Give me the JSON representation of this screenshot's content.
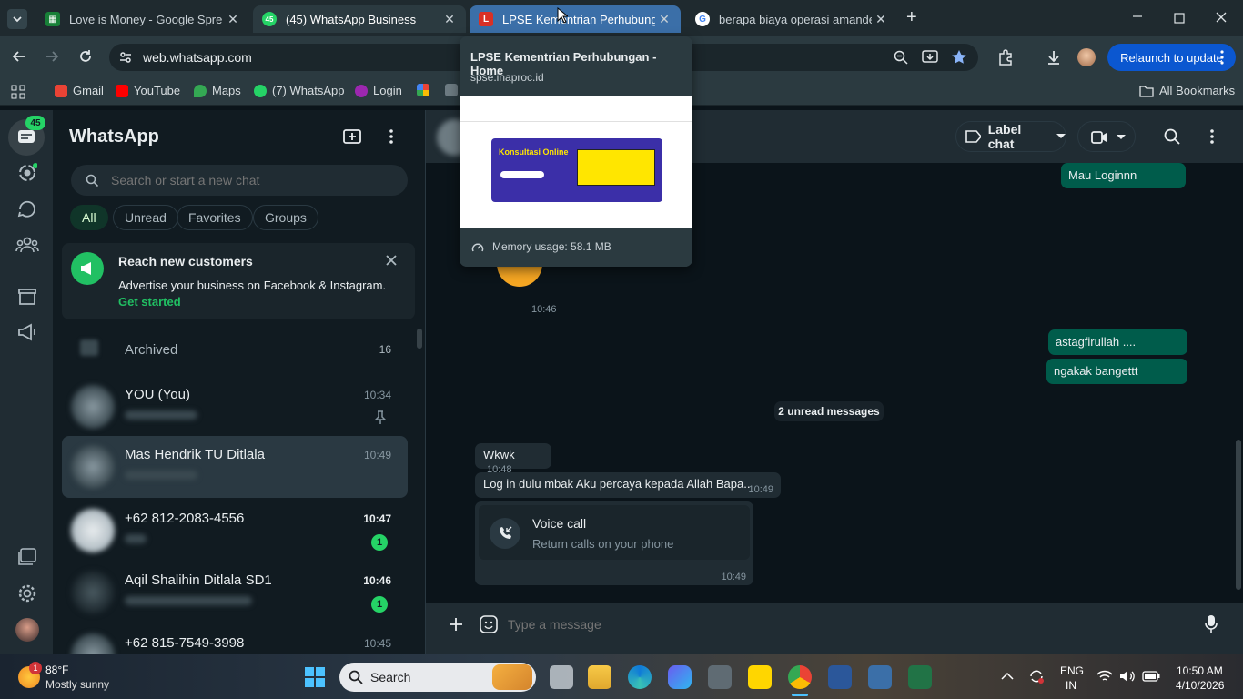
{
  "browser": {
    "tabs": [
      {
        "title": "Love is Money - Google Spreadsheets",
        "favicon": "sheets-icon",
        "color": "#188038"
      },
      {
        "title": "(45) WhatsApp Business",
        "favicon": "whatsapp-icon",
        "color": "#25d366",
        "badge": "45"
      },
      {
        "title": "LPSE Kementrian Perhubungan",
        "favicon": "lpse-icon",
        "color": "#d93025"
      },
      {
        "title": "berapa biaya operasi amandel",
        "favicon": "google-icon",
        "color": "#4285f4"
      }
    ],
    "url": "web.whatsapp.com",
    "relaunch_label": "Relaunch to update",
    "bookmarks": [
      {
        "label": "Gmail",
        "color": "#ea4335"
      },
      {
        "label": "YouTube",
        "color": "#ff0000"
      },
      {
        "label": "Maps",
        "color": "#34a853"
      },
      {
        "label": "(7) WhatsApp",
        "color": "#25d366"
      },
      {
        "label": "Login",
        "color": "#9c27b0"
      }
    ],
    "all_bookmarks": "All Bookmarks"
  },
  "hovercard": {
    "title": "LPSE Kementrian Perhubungan - Home",
    "domain": "spse.inaproc.id",
    "memory": "Memory usage: 58.1 MB",
    "preview_heading": "Konsultasi Online"
  },
  "whatsapp": {
    "nav_badge": "45",
    "title": "WhatsApp",
    "search_placeholder": "Search or start a new chat",
    "filters": [
      "All",
      "Unread",
      "Favorites",
      "Groups"
    ],
    "promo": {
      "title": "Reach new customers",
      "text": "Advertise your business on Facebook & Instagram.",
      "cta": "Get started"
    },
    "archived": {
      "label": "Archived",
      "count": "16"
    },
    "chats": [
      {
        "name": "YOU (You)",
        "time": "10:34",
        "pinned": true
      },
      {
        "name": "Mas Hendrik TU Ditlala",
        "time": "10:49",
        "selected": true
      },
      {
        "name": "+62 812-2083-4556",
        "time": "10:47",
        "unread": "1"
      },
      {
        "name": "Aqil Shalihin Ditlala SD1",
        "time": "10:46",
        "unread": "1"
      },
      {
        "name": "+62 815-7549-3998",
        "time": "10:45"
      }
    ],
    "header": {
      "label_chat": "Label chat"
    },
    "messages": {
      "out1": "Mau Loginnn",
      "sticker_time": "10:46",
      "out2": "astagfirullah ....",
      "out3": "ngakak bangettt",
      "unread_divider": "2 unread messages",
      "in1": {
        "text": "Wkwk",
        "time": "10:48"
      },
      "in2": {
        "text": "Log in dulu mbak Aku percaya kepada Allah Bapa..",
        "time": "10:49"
      },
      "call": {
        "title": "Voice call",
        "subtitle": "Return calls on your phone",
        "time": "10:49"
      }
    },
    "composer_placeholder": "Type a message"
  },
  "taskbar": {
    "weather_temp": "88°F",
    "weather_desc": "Mostly sunny",
    "weather_badge": "1",
    "search": "Search",
    "lang": "ENG",
    "region": "IN",
    "time": "10:50 AM",
    "date": "4/10/2026"
  }
}
